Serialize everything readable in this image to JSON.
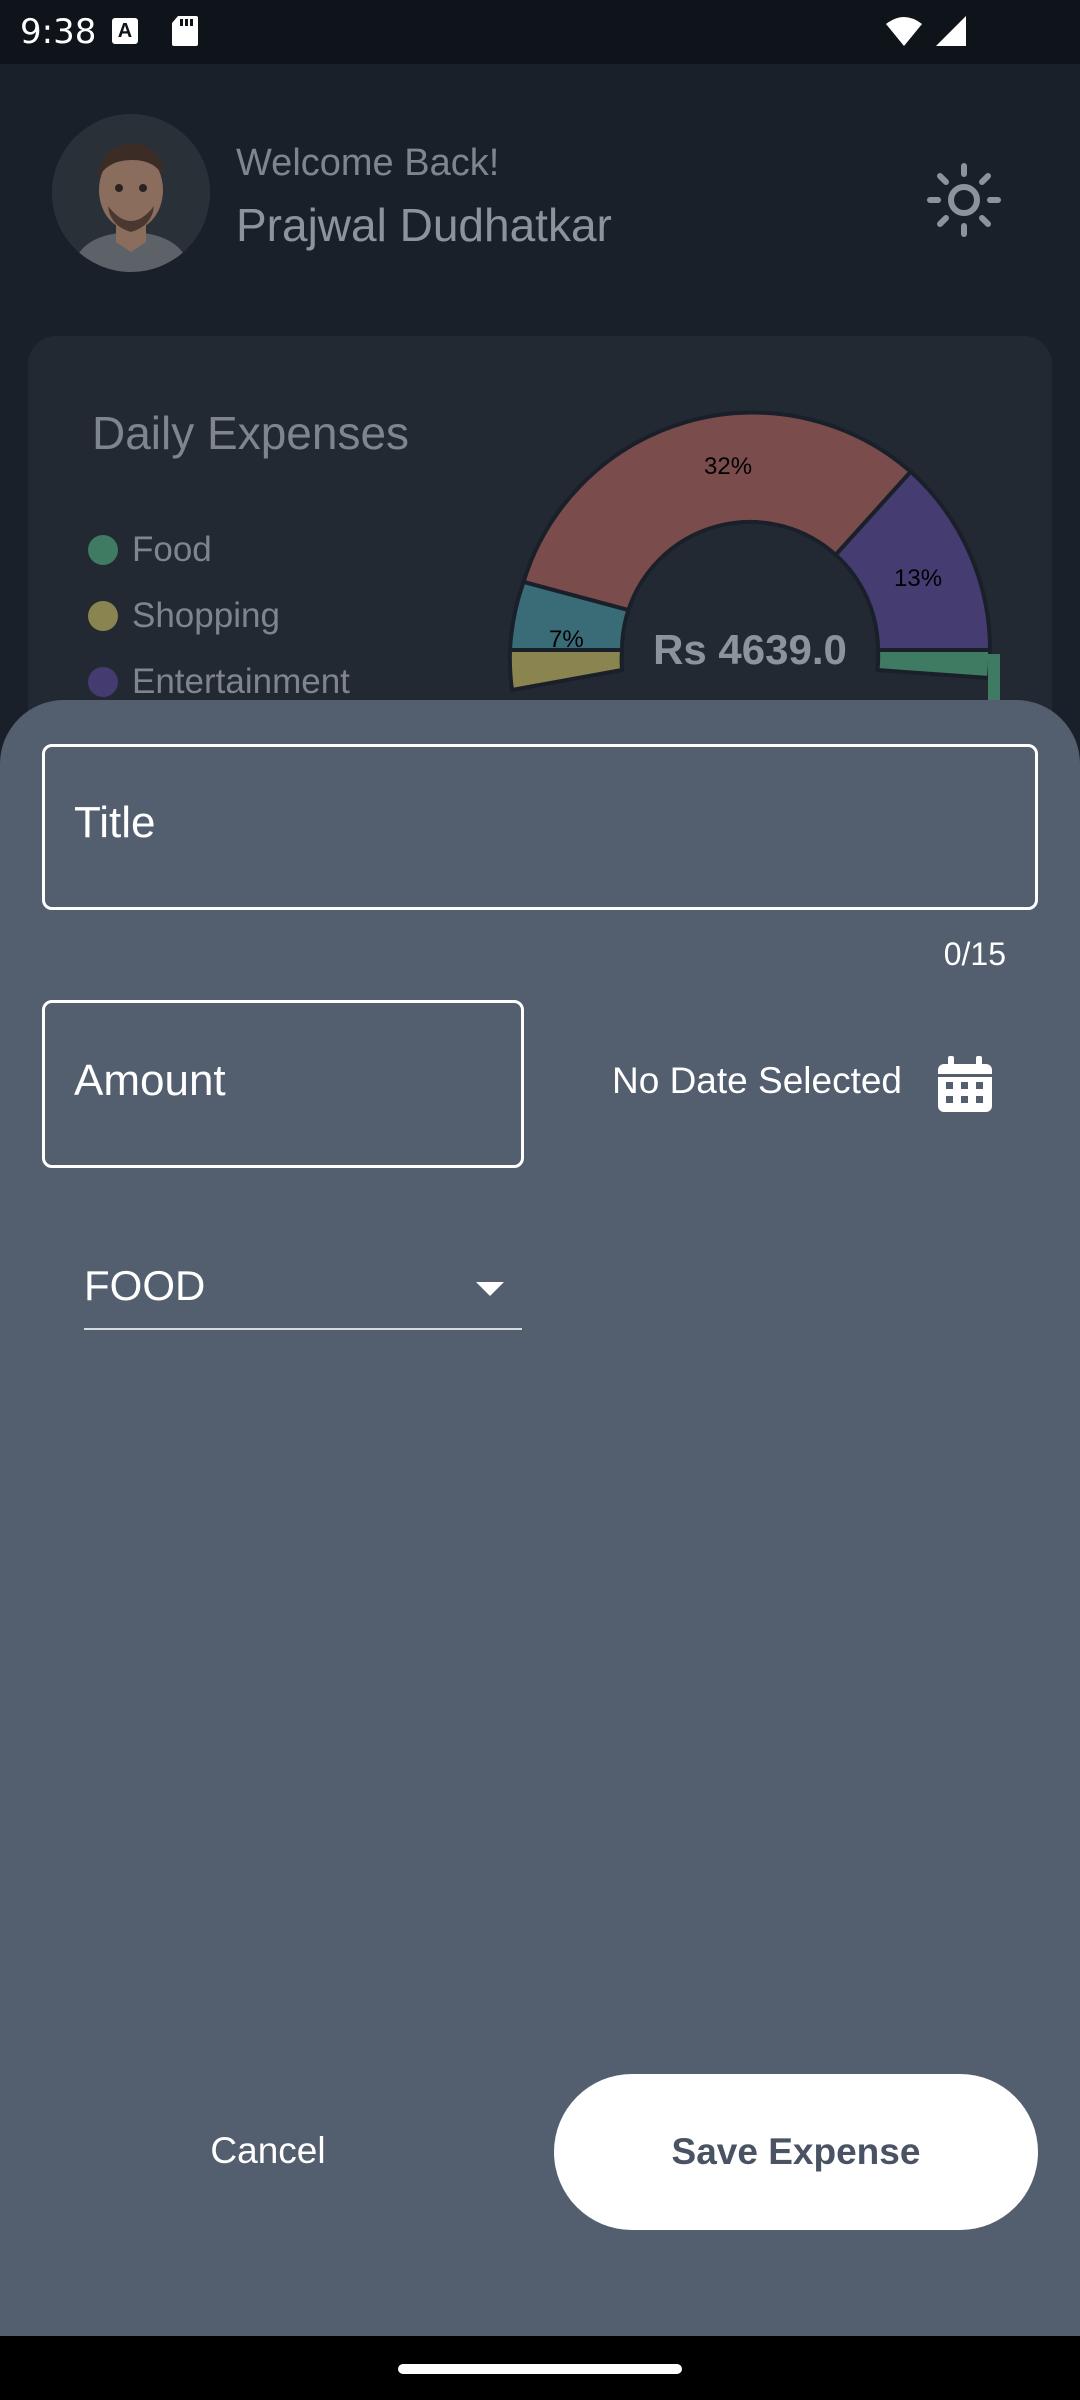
{
  "status_bar": {
    "time": "9:38",
    "notification_icon_letter": "A",
    "icons": [
      "a-notification-icon",
      "sd-card-icon",
      "wifi-icon",
      "signal-icon"
    ]
  },
  "header": {
    "welcome": "Welcome Back!",
    "user_name": "Prajwal Dudhatkar",
    "theme_icon": "sun-icon"
  },
  "expenses_card": {
    "title": "Daily Expenses",
    "legend": [
      {
        "label": "Food",
        "color": "#3f7a62"
      },
      {
        "label": "Shopping",
        "color": "#8a8450"
      },
      {
        "label": "Entertainment",
        "color": "#443b70"
      }
    ],
    "chart_data": {
      "type": "pie",
      "total_label": "Rs 4639.0",
      "slices": [
        {
          "label": "32%",
          "value": 32,
          "color": "#7a4c4c"
        },
        {
          "label": "13%",
          "value": 13,
          "color": "#453c72"
        },
        {
          "label": "7%",
          "value": 7,
          "color": "#3a6c78"
        }
      ]
    }
  },
  "form": {
    "title_placeholder": "Title",
    "title_counter": "0/15",
    "amount_placeholder": "Amount",
    "date_text": "No Date Selected",
    "date_icon": "calendar-icon",
    "category_value": "FOOD",
    "category_icon": "dropdown-arrow-icon"
  },
  "actions": {
    "cancel_label": "Cancel",
    "save_label": "Save Expense"
  },
  "colors": {
    "sheet_background": "#535e6e",
    "app_background": "#131820",
    "save_button_background": "#ffffff"
  }
}
